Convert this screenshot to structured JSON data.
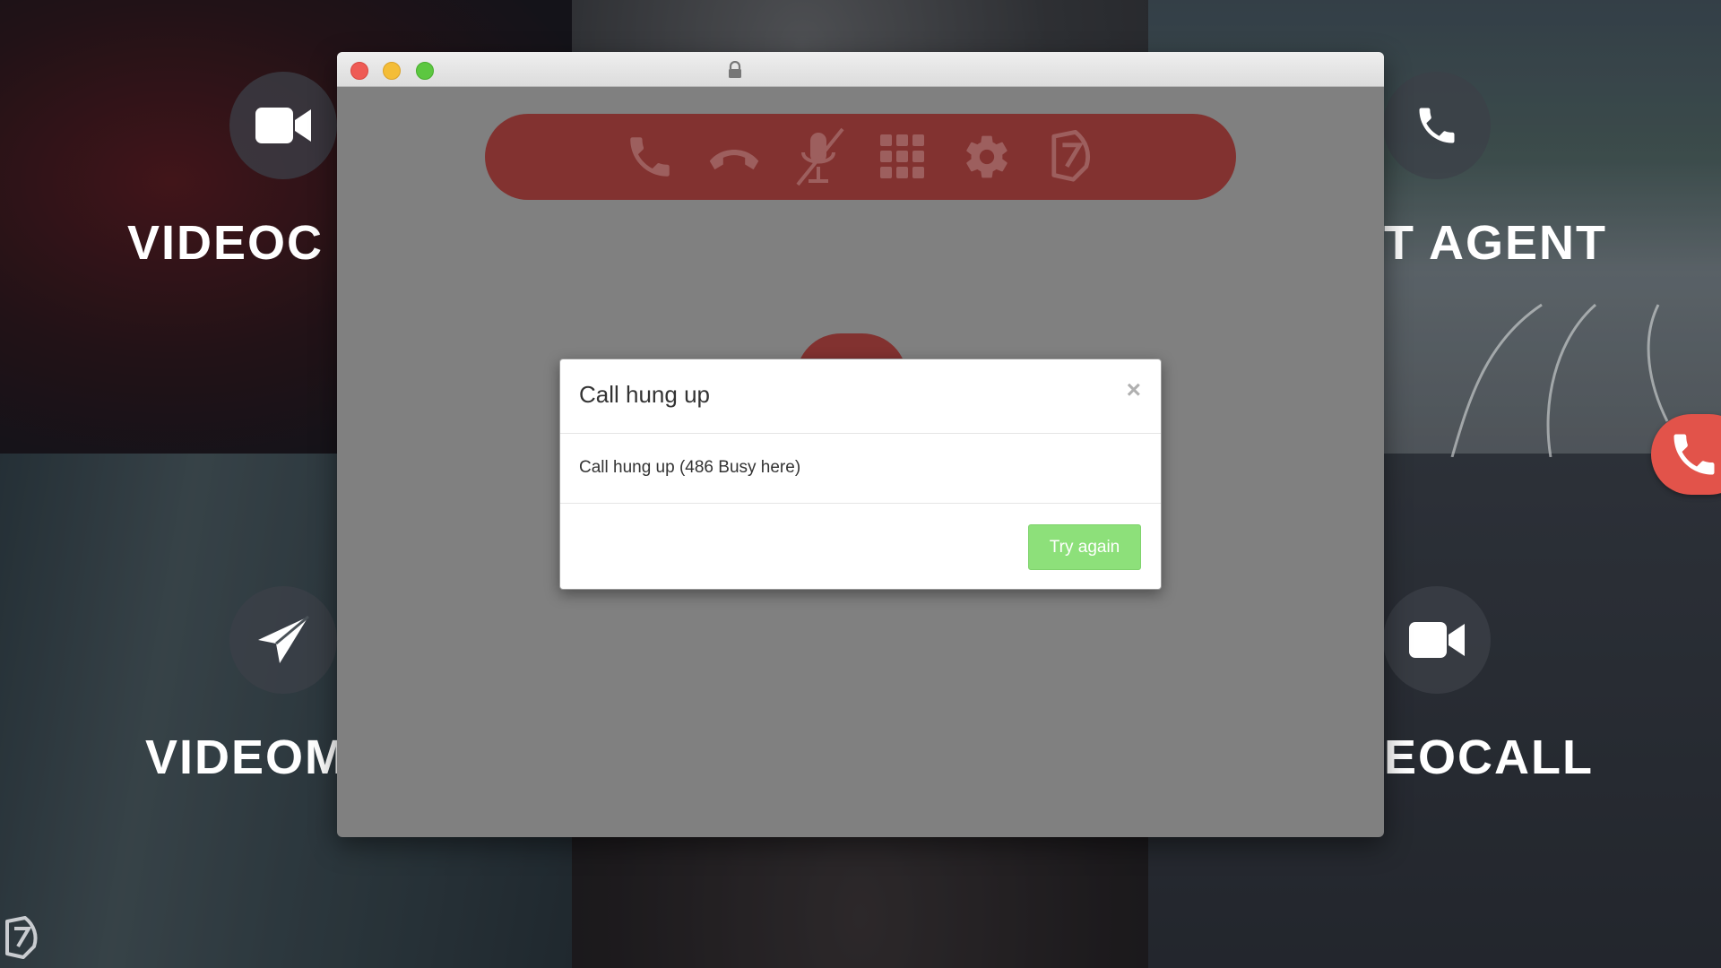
{
  "background": {
    "tiles": [
      {
        "label": "VIDEOC",
        "icon": "video-camera-icon"
      },
      {
        "label": "",
        "icon": ""
      },
      {
        "label": "T AGENT",
        "icon": "phone-icon"
      },
      {
        "label": "VIDEOM",
        "icon": "paper-plane-icon"
      },
      {
        "label": "",
        "icon": ""
      },
      {
        "label": "EOCALL",
        "icon": "video-camera-icon"
      }
    ],
    "fab_icon": "phone-icon",
    "corner_logo_icon": "leaf-logo-icon"
  },
  "window": {
    "controls": [
      "close",
      "minimize",
      "maximize"
    ],
    "lock_icon": "lock-icon"
  },
  "toolbar": {
    "accent_color": "#823230",
    "buttons": [
      {
        "icon": "phone-icon"
      },
      {
        "icon": "hang-up-icon"
      },
      {
        "icon": "mute-mic-icon"
      },
      {
        "icon": "dialpad-icon"
      },
      {
        "icon": "gear-icon"
      },
      {
        "icon": "leaf-logo-icon"
      }
    ]
  },
  "modal": {
    "title": "Call hung up",
    "close_glyph": "×",
    "message": "Call hung up (486 Busy here)",
    "button_label": "Try again",
    "button_color": "#8de07a"
  }
}
